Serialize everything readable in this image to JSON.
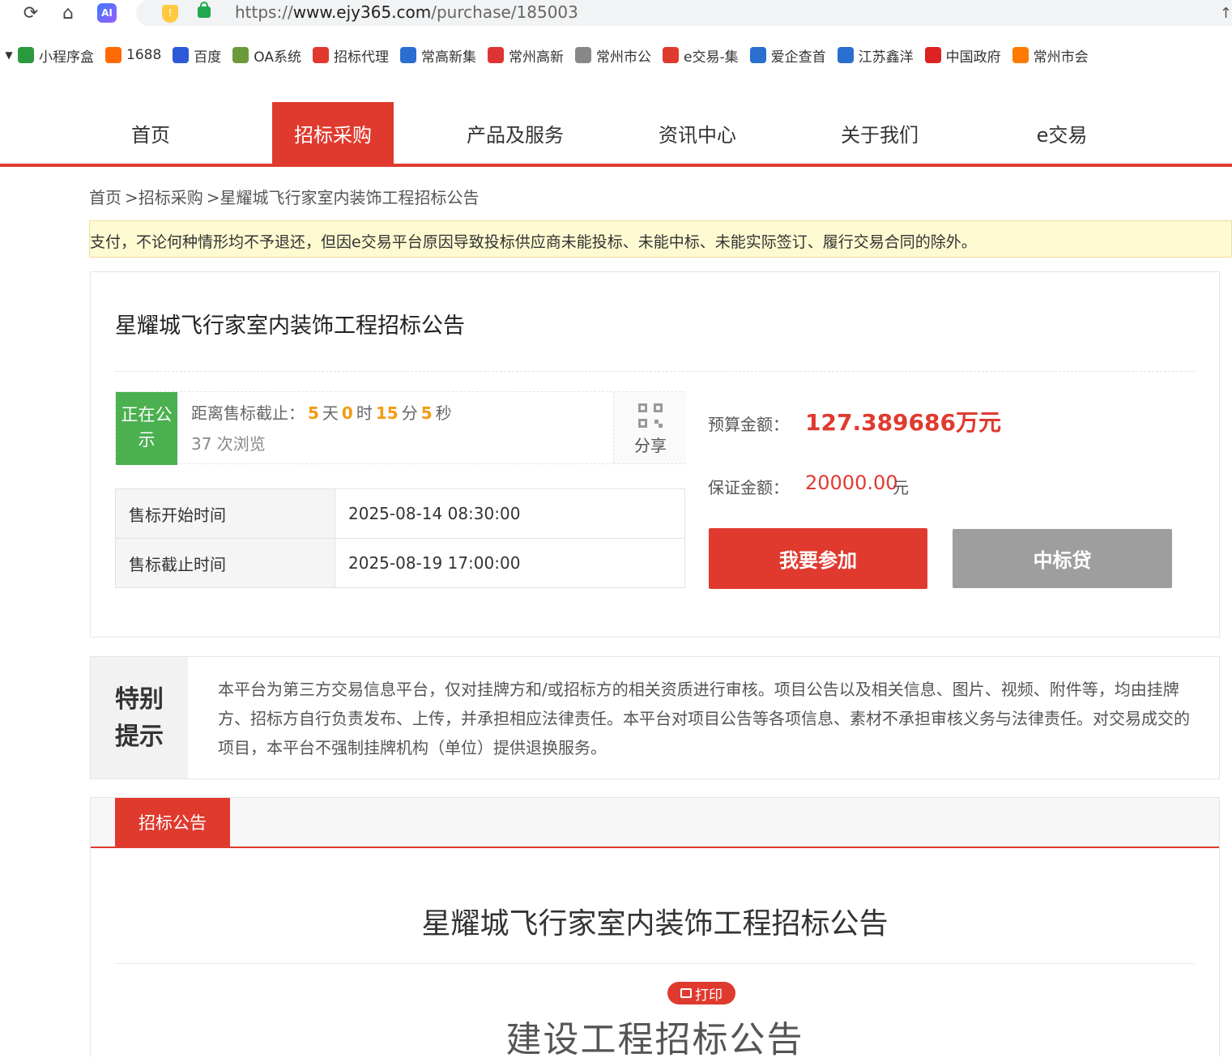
{
  "browser": {
    "url_prefix": "https://",
    "url_domain": "www.ejy365.com",
    "url_path": "/purchase/185003",
    "bookmarks": [
      {
        "label": "小程序盒",
        "icon": "shield-icon",
        "color": "#2b9a3e"
      },
      {
        "label": "1688",
        "icon": "alibaba-icon",
        "color": "#ff6a00"
      },
      {
        "label": "百度",
        "icon": "baidu-paw-icon",
        "color": "#2e5ad8"
      },
      {
        "label": "OA系统",
        "icon": "oa-icon",
        "color": "#6b9a3a"
      },
      {
        "label": "招标代理",
        "icon": "pdf-icon",
        "color": "#e03a2f"
      },
      {
        "label": "常高新集",
        "icon": "company-icon",
        "color": "#2a6fd0"
      },
      {
        "label": "常州高新",
        "icon": "emblem-icon",
        "color": "#d33"
      },
      {
        "label": "常州市公",
        "icon": "globe-icon",
        "color": "#888"
      },
      {
        "label": "e交易-集",
        "icon": "ejy-icon",
        "color": "#e03a2f"
      },
      {
        "label": "爱企查首",
        "icon": "aiqicha-icon",
        "color": "#2a6fd0"
      },
      {
        "label": "江苏鑫洋",
        "icon": "at-icon",
        "color": "#2a6fd0"
      },
      {
        "label": "中国政府",
        "icon": "national-emblem-icon",
        "color": "#d22"
      },
      {
        "label": "常州市会",
        "icon": "sun-icon",
        "color": "#ff7a00"
      }
    ]
  },
  "nav": {
    "items": [
      "首页",
      "招标采购",
      "产品及服务",
      "资讯中心",
      "关于我们",
      "e交易"
    ],
    "active_index": 1
  },
  "breadcrumb": [
    "首页",
    ">招标采购",
    ">星耀城飞行家室内装饰工程招标公告"
  ],
  "notice": "支付，不论何种情形均不予退还，但因e交易平台原因导致投标供应商未能投标、未能中标、未能实际签订、履行交易合同的除外。",
  "project": {
    "title": "星耀城飞行家室内装饰工程招标公告",
    "status": "正在公示",
    "countdown_label": "距离售标截止：",
    "countdown": {
      "days": "5",
      "days_unit": "天",
      "hours": "0",
      "hours_unit": "时",
      "minutes": "15",
      "minutes_unit": "分",
      "seconds": "5",
      "seconds_unit": "秒"
    },
    "views": "37 次浏览",
    "share_label": "分享",
    "times": [
      {
        "label": "售标开始时间",
        "value": "2025-08-14 08:30:00"
      },
      {
        "label": "售标截止时间",
        "value": "2025-08-19 17:00:00"
      }
    ],
    "budget_label": "预算金额：",
    "budget_value": "127.389686万元",
    "deposit_label": "保证金额：",
    "deposit_value": "20000.00",
    "deposit_unit": "元",
    "join_button": "我要参加",
    "loan_button": "中标贷"
  },
  "tip": {
    "label_line1": "特别",
    "label_line2": "提示",
    "text": "本平台为第三方交易信息平台，仅对挂牌方和/或招标方的相关资质进行审核。项目公告以及相关信息、图片、视频、附件等，均由挂牌方、招标方自行负责发布、上传，并承担相应法律责任。本平台对项目公告等各项信息、素材不承担审核义务与法律责任。对交易成交的项目，本平台不强制挂牌机构（单位）提供退换服务。"
  },
  "announcement": {
    "tab": "招标公告",
    "title": "星耀城飞行家室内装饰工程招标公告",
    "print_label": "打印",
    "doc_title": "建设工程招标公告"
  }
}
